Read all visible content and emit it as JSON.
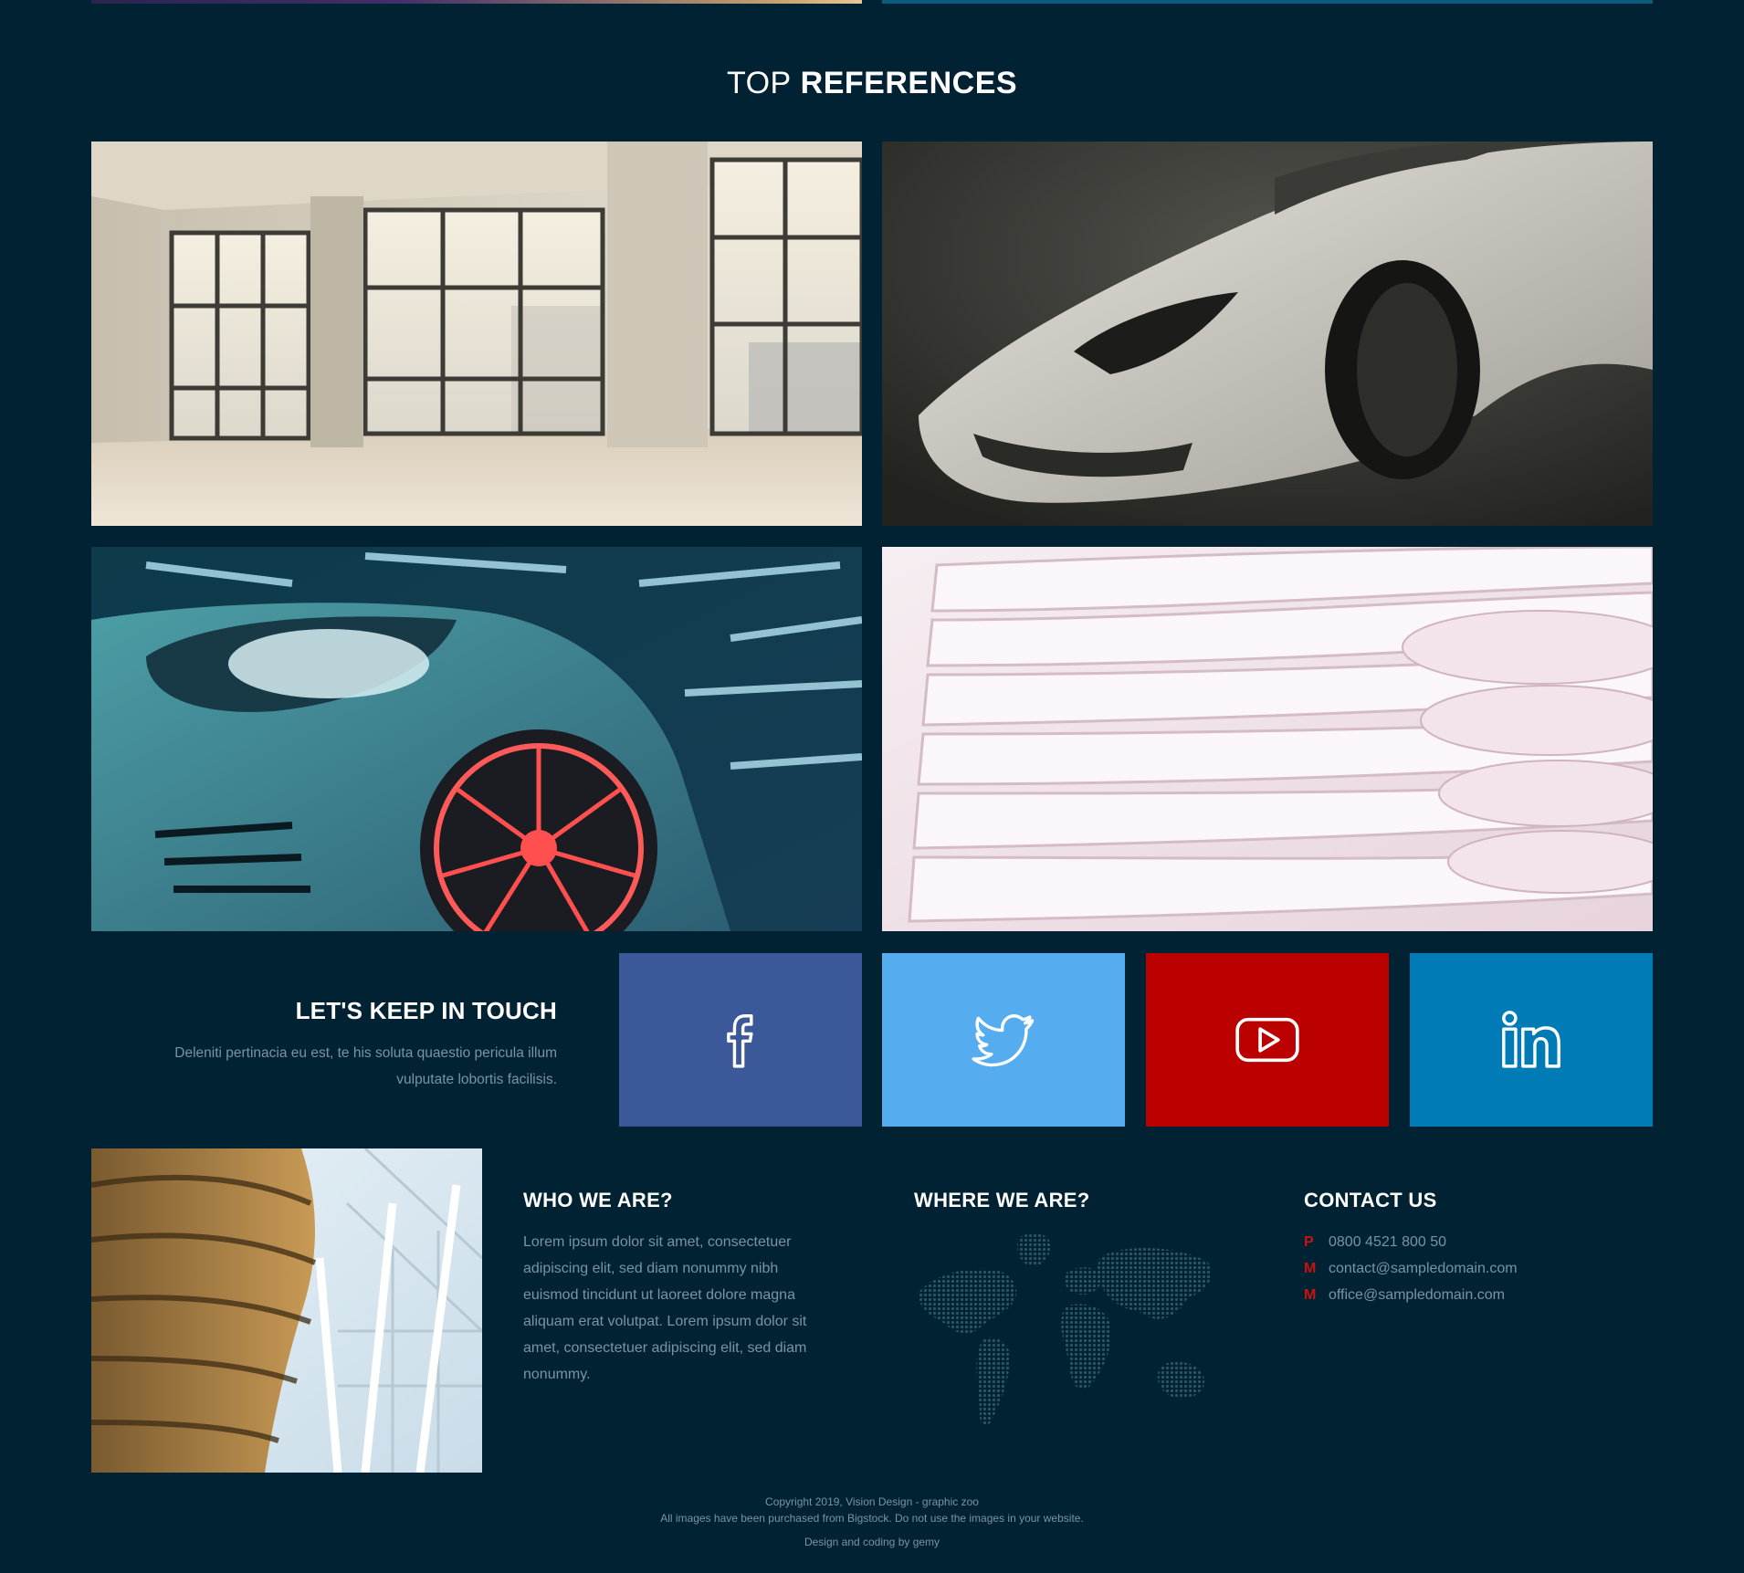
{
  "section": {
    "title_light": "TOP",
    "title_bold": "REFERENCES"
  },
  "references": [
    {
      "name": "empty-office-loft",
      "subject": "Empty loft interior with large windows"
    },
    {
      "name": "white-sports-car",
      "subject": "White sports car front in dark studio"
    },
    {
      "name": "teal-sports-car",
      "subject": "Teal sports car with red rims"
    },
    {
      "name": "white-curved-wall",
      "subject": "White curved layered architecture"
    }
  ],
  "touch": {
    "title": "LET'S KEEP IN TOUCH",
    "text_line1": "Deleniti pertinacia eu est, te his soluta quaestio pericula illum",
    "text_line2": "vulputate lobortis facilisis."
  },
  "social": [
    {
      "name": "facebook",
      "icon": "facebook-icon",
      "color": "#3b5998"
    },
    {
      "name": "twitter",
      "icon": "twitter-icon",
      "color": "#55acee"
    },
    {
      "name": "youtube",
      "icon": "youtube-icon",
      "color": "#bb0000"
    },
    {
      "name": "linkedin",
      "icon": "linkedin-icon",
      "color": "#007bb5"
    }
  ],
  "who": {
    "title": "WHO WE ARE?",
    "text": "Lorem ipsum dolor sit amet, consectetuer adipiscing elit, sed diam nonummy nibh euismod tincidunt ut laoreet dolore magna aliquam erat volutpat. Lorem ipsum dolor sit amet, consectetuer adipiscing elit, sed diam nonummy."
  },
  "where": {
    "title": "WHERE WE ARE?",
    "map_icon": "world-map-icon"
  },
  "contact": {
    "title": "CONTACT US",
    "phone_tag": "P",
    "phone": "0800 4521 800 50",
    "mail1_tag": "M",
    "mail1": "contact@sampledomain.com",
    "mail2_tag": "M",
    "mail2": "office@sampledomain.com"
  },
  "footer": {
    "copyright": "Copyright 2019, Vision Design - graphic zoo",
    "notice": "All images have been purchased from Bigstock. Do not use the images in your website.",
    "credit": "Design and coding by gemy"
  },
  "colors": {
    "background": "#002232",
    "muted_text": "#7a93a6",
    "contact_tag": "#cc1111",
    "facebook": "#3b5998",
    "twitter": "#55acee",
    "youtube": "#bb0000",
    "linkedin": "#007bb5"
  }
}
